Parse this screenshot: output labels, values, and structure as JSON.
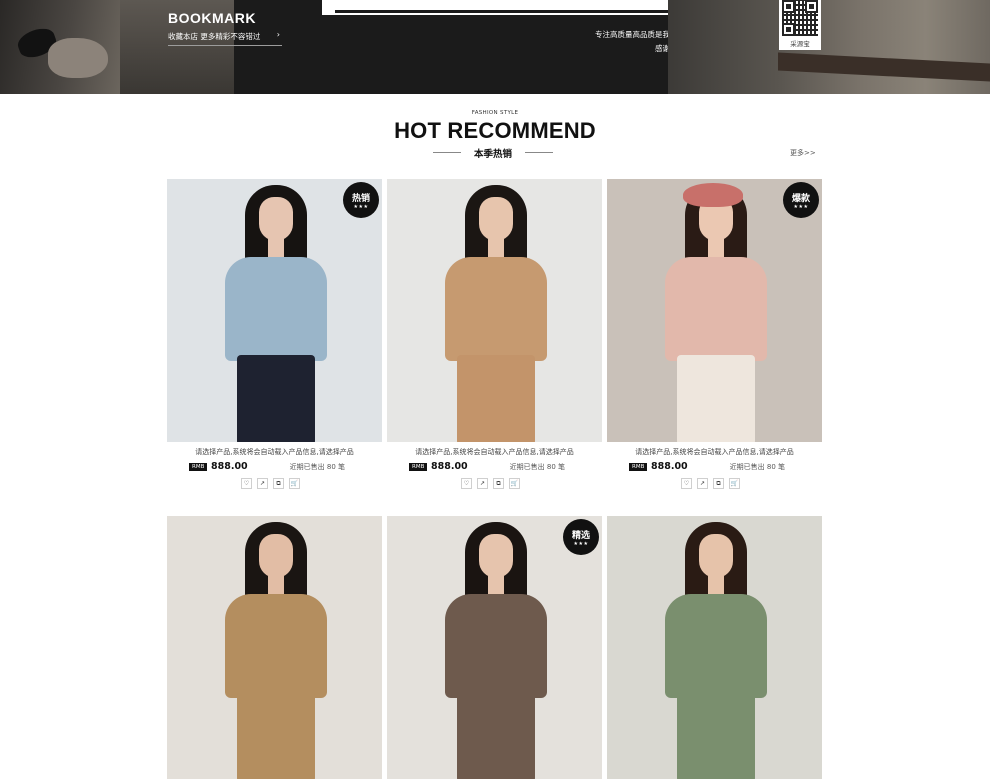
{
  "banner": {
    "bookmark_title": "BOOKMARK",
    "bookmark_sub": "收藏本店 更多精彩不容错过",
    "bookmark_arrow": "›",
    "slogan_line1": "专注高质量高品质是我们对顾客的承诺，",
    "slogan_line2": "感谢一路有您的支持！",
    "qr_label": "采源宝"
  },
  "section": {
    "kicker": "FASHION STYLE",
    "title": "HOT RECOMMEND",
    "subtitle": "本季热销",
    "more": "更多>>"
  },
  "products": [
    {
      "badge": "热销",
      "badge_stars": "★★★",
      "desc": "请选择产品,系统将会自动载入产品信息,请选择产品",
      "currency": "RMB",
      "price": "888.00",
      "sold": "近期已售出 80 笔",
      "colors": {
        "bg": "#dfe3e6",
        "top": "#9ab5c9",
        "bottom": "#1e2230",
        "hair": "#161311",
        "skin": "#e6c5b1"
      }
    },
    {
      "badge": "",
      "badge_stars": "",
      "desc": "请选择产品,系统将会自动载入产品信息,请选择产品",
      "currency": "RMB",
      "price": "888.00",
      "sold": "近期已售出 80 笔",
      "colors": {
        "bg": "#e6e6e4",
        "top": "#c69a70",
        "bottom": "#c3946a",
        "hair": "#1b1613",
        "skin": "#e7c5ad"
      }
    },
    {
      "badge": "爆款",
      "badge_stars": "★★★",
      "desc": "请选择产品,系统将会自动载入产品信息,请选择产品",
      "currency": "RMB",
      "price": "888.00",
      "sold": "近期已售出 80 笔",
      "colors": {
        "bg": "#c9c1b9",
        "top": "#e2b8ab",
        "bottom": "#eee6dd",
        "hair": "#2a1b15",
        "skin": "#ebc8b2",
        "hat": "#c8706a"
      }
    },
    {
      "badge": "",
      "badge_stars": "",
      "desc": "",
      "currency": "",
      "price": "",
      "sold": "",
      "colors": {
        "bg": "#e3dfd9",
        "top": "#b48e5f",
        "bottom": "#b48e5f",
        "hair": "#1a1512",
        "skin": "#e2bda5"
      }
    },
    {
      "badge": "精选",
      "badge_stars": "★★★",
      "desc": "",
      "currency": "",
      "price": "",
      "sold": "",
      "colors": {
        "bg": "#e4e1dc",
        "top": "#6e5a4d",
        "bottom": "#6e5a4d",
        "hair": "#1a1411",
        "skin": "#e6c4ad"
      }
    },
    {
      "badge": "",
      "badge_stars": "",
      "desc": "",
      "currency": "",
      "price": "",
      "sold": "",
      "colors": {
        "bg": "#d9d8d1",
        "top": "#7a8f6e",
        "bottom": "#7a8f6e",
        "hair": "#2a1b14",
        "skin": "#e6c3aa"
      }
    }
  ],
  "action_icons": [
    "heart-icon",
    "share-icon",
    "compare-icon",
    "cart-icon"
  ],
  "action_glyphs": [
    "♡",
    "↗",
    "⧉",
    "🛒"
  ]
}
